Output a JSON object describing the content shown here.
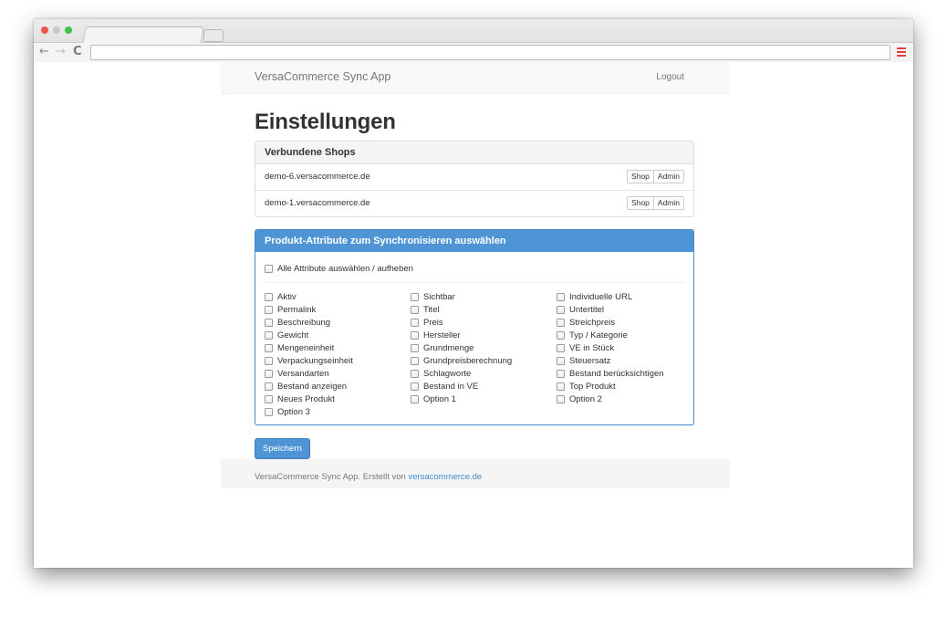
{
  "browser": {
    "controls": {
      "back_glyph": "←",
      "forward_glyph": "→",
      "reload_glyph": "C"
    },
    "address_value": ""
  },
  "navbar": {
    "brand": "VersaCommerce Sync App",
    "logout": "Logout"
  },
  "page": {
    "title": "Einstellungen"
  },
  "shops": {
    "heading": "Verbundene Shops",
    "rows": [
      {
        "name": "demo-6.versacommerce.de",
        "shop_label": "Shop",
        "admin_label": "Admin"
      },
      {
        "name": "demo-1.versacommerce.de",
        "shop_label": "Shop",
        "admin_label": "Admin"
      }
    ]
  },
  "attributes": {
    "heading": "Produkt-Attribute zum Synchronisieren auswählen",
    "select_all_label": "Alle Attribute auswählen / aufheben",
    "columns": [
      [
        "Aktiv",
        "Permalink",
        "Beschreibung",
        "Gewicht",
        "Mengeneinheit",
        "Verpackungseinheit",
        "Versandarten",
        "Bestand anzeigen",
        "Neues Produkt",
        "Option 3"
      ],
      [
        "Sichtbar",
        "Titel",
        "Preis",
        "Hersteller",
        "Grundmenge",
        "Grundpreisberechnung",
        "Schlagworte",
        "Bestand in VE",
        "Option 1"
      ],
      [
        "Individuelle URL",
        "Untertitel",
        "Streichpreis",
        "Typ / Kategorie",
        "VE in Stück",
        "Steuersatz",
        "Bestand berücksichtigen",
        "Top Produkt",
        "Option 2"
      ]
    ]
  },
  "actions": {
    "save_label": "Speichern"
  },
  "footer": {
    "text": "VersaCommerce Sync App. Erstellt von ",
    "link": "versacommerce.de"
  },
  "colors": {
    "primary": "#4f95d5",
    "close": "#f3524e",
    "zoom": "#41c248",
    "menu": "#d9453e"
  }
}
